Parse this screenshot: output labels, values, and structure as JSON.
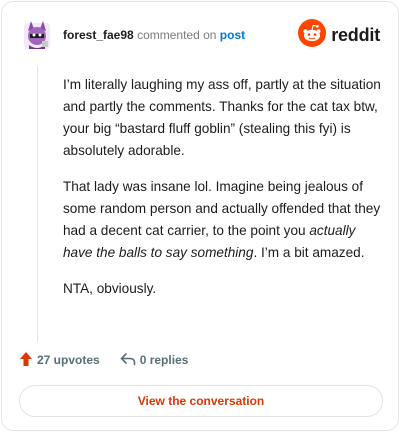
{
  "header": {
    "username": "forest_fae98",
    "action_text": "commented on",
    "post_link": "post",
    "brand": "reddit"
  },
  "comment": {
    "p1": "I’m literally laughing my ass off, partly at the situation and partly the comments. Thanks for the cat tax btw, your big “bastard fluff goblin” (stealing this fyi) is absolutely adorable.",
    "p2_before": "That lady was insane lol. Imagine being jealous of some random person and actually offended that they had a decent cat carrier, to the point you ",
    "p2_italic": "actually have the balls to say something",
    "p2_after": ". I’m a bit amazed.",
    "p3": "NTA, obviously."
  },
  "actions": {
    "upvotes": "27 upvotes",
    "replies": "0 replies"
  },
  "footer": {
    "view_button": "View the conversation"
  },
  "colors": {
    "accent": "#d93900",
    "link": "#0079d3",
    "brand_orange": "#ff4500",
    "muted": "#576f76"
  },
  "icons": {
    "avatar": "avatar-icon",
    "brand": "reddit-snoo-icon",
    "upvote": "upvote-arrow-icon",
    "reply": "reply-arrow-icon"
  }
}
